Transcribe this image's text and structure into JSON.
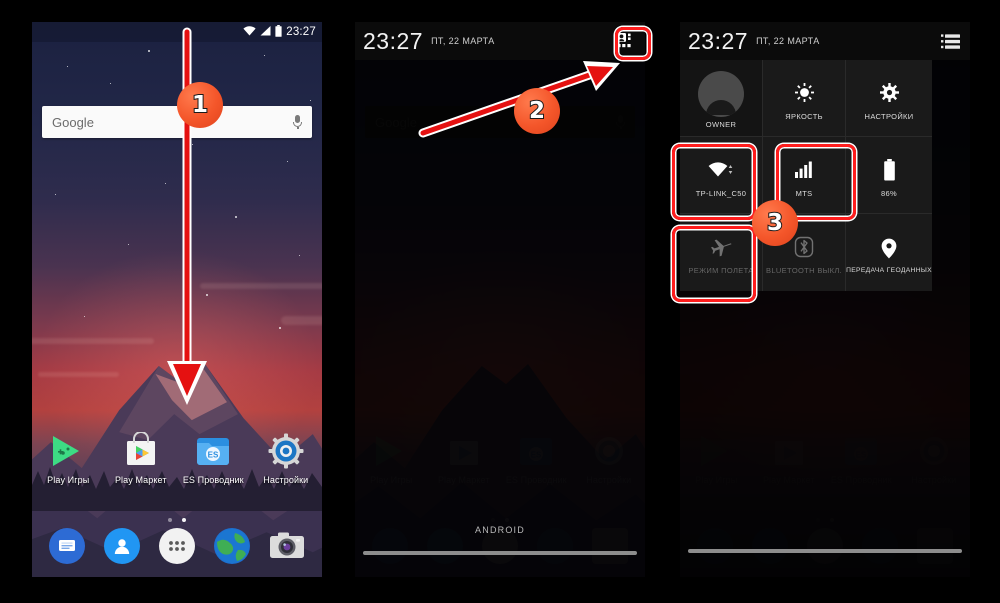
{
  "panels": [
    {
      "id": "home-screen",
      "statusbar": {
        "clock": "23:27",
        "wifi_icon": "wifi-icon",
        "signal_icon": "signal-icon",
        "battery_icon": "battery-icon"
      },
      "search": {
        "placeholder": "Google",
        "mic_icon": "microphone-icon"
      },
      "apps": [
        {
          "label": "Play Игры",
          "icon": "play-games-icon"
        },
        {
          "label": "Play Маркет",
          "icon": "play-store-icon"
        },
        {
          "label": "ES Проводник",
          "icon": "es-file-explorer-icon"
        },
        {
          "label": "Настройки",
          "icon": "settings-gear-icon"
        }
      ],
      "page_dots": {
        "count": 2,
        "active_index": 1
      },
      "dock": [
        {
          "icon": "messages-icon"
        },
        {
          "icon": "contacts-icon"
        },
        {
          "icon": "app-drawer-icon"
        },
        {
          "icon": "browser-globe-icon"
        },
        {
          "icon": "camera-icon"
        }
      ],
      "annotation": {
        "number": "1",
        "gesture": "swipe-down-arrow"
      }
    },
    {
      "id": "notification-shade",
      "shade": {
        "time": "23:27",
        "date": "ПТ, 22 МАРТА",
        "button_icon": "quick-settings-grid-icon"
      },
      "brand": "ANDROID",
      "annotation": {
        "number": "2",
        "gesture": "pointer-arrow-to-quick-settings-button"
      }
    },
    {
      "id": "quick-settings",
      "shade": {
        "time": "23:27",
        "date": "ПТ, 22 МАРТА",
        "button_icon": "notification-list-icon"
      },
      "tiles": [
        {
          "label": "OWNER",
          "icon": "user-avatar-icon",
          "state": "on",
          "highlighted": false
        },
        {
          "label": "ЯРКОСТЬ",
          "icon": "brightness-sun-icon",
          "state": "on",
          "highlighted": false
        },
        {
          "label": "НАСТРОЙКИ",
          "icon": "settings-gear-icon",
          "state": "on",
          "highlighted": false
        },
        {
          "label": "TP-LINK_C50",
          "icon": "wifi-icon",
          "state": "on",
          "highlighted": true
        },
        {
          "label": "MTS",
          "icon": "cellular-signal-icon",
          "state": "on",
          "highlighted": true
        },
        {
          "label": "86%",
          "icon": "battery-icon",
          "state": "on",
          "highlighted": false
        },
        {
          "label": "РЕЖИМ ПОЛЕТА",
          "icon": "airplane-icon",
          "state": "off",
          "highlighted": true
        },
        {
          "label": "BLUETOOTH ВЫКЛ.",
          "icon": "bluetooth-icon",
          "state": "off",
          "highlighted": false
        },
        {
          "label": "ПЕРЕДАЧА ГЕОДАННЫХ",
          "icon": "location-pin-icon",
          "state": "on",
          "highlighted": false
        }
      ],
      "annotation": {
        "number": "3"
      }
    }
  ],
  "colors": {
    "badge": "#f4562a",
    "highlight": "#ff1d1d",
    "shade_background": "#0b0b0b",
    "tile_background": "#1a1a1a"
  }
}
